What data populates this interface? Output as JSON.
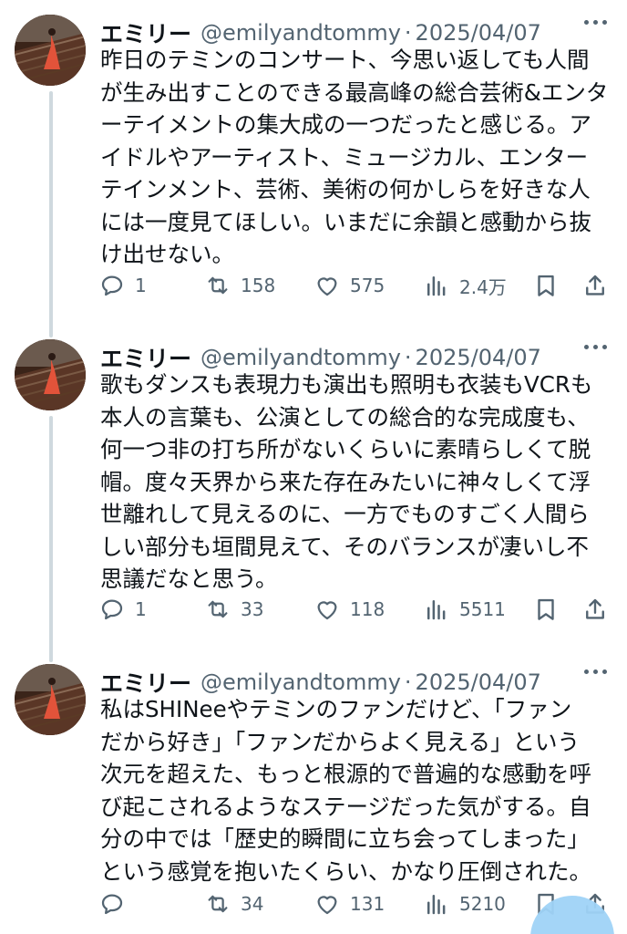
{
  "tweets": [
    {
      "author": {
        "name": "エミリー",
        "handle": "@emilyandtommy",
        "separator": "·",
        "date": "2025/04/07"
      },
      "lines": [
        "昨日のテミンのコンサート、今思い返しても人間",
        "が生み出すことのできる最高峰の総合芸術&エンタ",
        "ーテイメントの集大成の一つだったと感じる。ア",
        "イドルやアーティスト、ミュージカル、エンター",
        "テインメント、芸術、美術の何かしらを好きな人",
        "には一度見てほしい。いまだに余韻と感動から抜",
        "け出せない。"
      ],
      "stats": {
        "replies": "1",
        "reposts": "158",
        "likes": "575",
        "views": "2.4万"
      }
    },
    {
      "author": {
        "name": "エミリー",
        "handle": "@emilyandtommy",
        "separator": "·",
        "date": "2025/04/07"
      },
      "lines": [
        "歌もダンスも表現力も演出も照明も衣装もVCRも",
        "本人の言葉も、公演としての総合的な完成度も、",
        "何一つ非の打ち所がないくらいに素晴らしくて脱",
        "帽。度々天界から来た存在みたいに神々しくて浮",
        "世離れして見えるのに、一方でものすごく人間ら",
        "しい部分も垣間見えて、そのバランスが凄いし不",
        "思議だなと思う。"
      ],
      "stats": {
        "replies": "1",
        "reposts": "33",
        "likes": "118",
        "views": "5511"
      }
    },
    {
      "author": {
        "name": "エミリー",
        "handle": "@emilyandtommy",
        "separator": "·",
        "date": "2025/04/07"
      },
      "lines": [
        "私はSHINeeやテミンのファンだけど、「ファン",
        "だから好き」「ファンだからよく見える」という",
        "次元を超えた、もっと根源的で普遍的な感動を呼",
        "び起こされるようなステージだった気がする。自",
        "分の中では「歴史的瞬間に立ち会ってしまった」",
        "という感覚を抱いたくらい、かなり圧倒された。"
      ],
      "stats": {
        "replies": "",
        "reposts": "34",
        "likes": "131",
        "views": "5210"
      }
    }
  ],
  "colors": {
    "text": "#0f1419",
    "muted": "#536471",
    "thread": "#cfd9de",
    "fab": "#1d9bf0"
  },
  "icons": [
    "reply-icon",
    "repost-icon",
    "like-icon",
    "views-icon",
    "bookmark-icon",
    "share-icon",
    "more-icon"
  ]
}
